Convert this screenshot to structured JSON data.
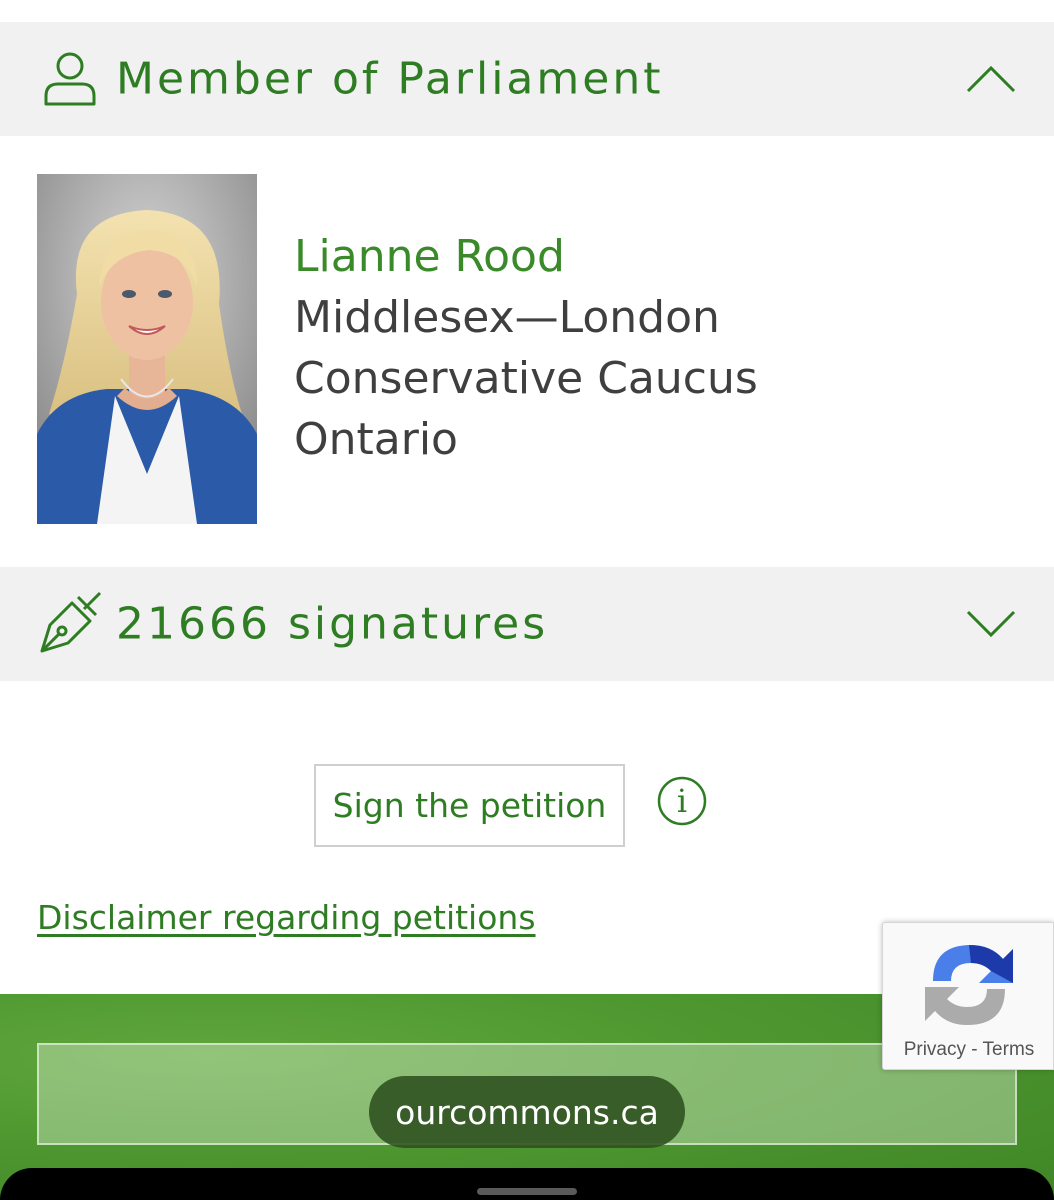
{
  "mp_section": {
    "title": "Member of Parliament",
    "icon": "person-outline-icon",
    "chevron": "chevron-up-icon"
  },
  "member": {
    "name": "Lianne Rood",
    "riding": "Middlesex—London",
    "caucus": "Conservative Caucus",
    "province": "Ontario"
  },
  "signatures_section": {
    "title": "21666 signatures",
    "icon": "pen-sign-icon",
    "chevron": "chevron-down-icon"
  },
  "actions": {
    "sign_label": "Sign the petition",
    "info_glyph": "i",
    "disclaimer_link": "Disclaimer regarding petitions"
  },
  "browser": {
    "url": "ourcommons.ca"
  },
  "recaptcha": {
    "privacy": "Privacy",
    "separator": " - ",
    "terms": "Terms"
  },
  "colors": {
    "brand_green": "#2e7d23",
    "header_bg": "#f1f1f1"
  }
}
